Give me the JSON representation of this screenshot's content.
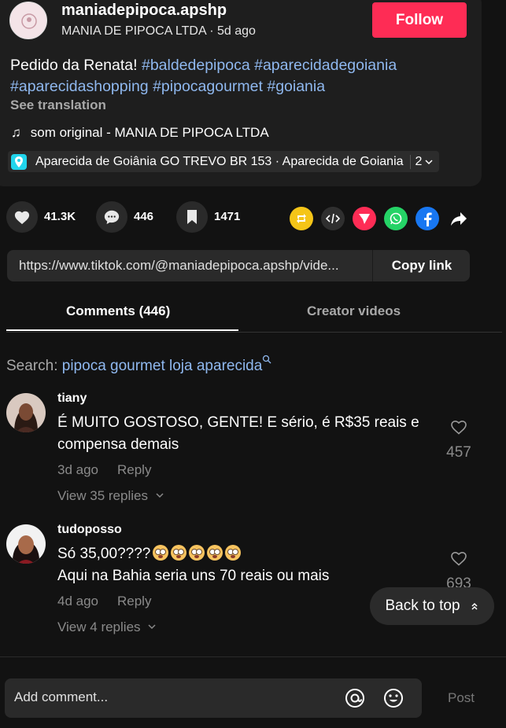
{
  "header": {
    "username": "maniadepipoca.apshp",
    "display_name": "MANIA DE PIPOCA LTDA",
    "separator": " · ",
    "time_ago": "5d ago",
    "follow_label": "Follow"
  },
  "description": {
    "text": "Pedido da Renata! ",
    "tags": [
      "#baldedepipoca",
      "#aparecidadegoiania",
      "#aparecidashopping",
      "#pipocagourmet",
      "#goiania"
    ],
    "see_translation": "See translation"
  },
  "music": {
    "note": "♫",
    "label": "som original - MANIA DE PIPOCA LTDA"
  },
  "location": {
    "text": "Aparecida de Goiânia GO TREVO BR 153 · Aparecida de Goiania",
    "count": "2"
  },
  "actions": {
    "likes": "41.3K",
    "comments": "446",
    "saves": "1471"
  },
  "link": {
    "url": "https://www.tiktok.com/@maniadepipoca.apshp/vide...",
    "copy_label": "Copy link"
  },
  "tabs": {
    "comments": "Comments (446)",
    "creator": "Creator videos"
  },
  "search": {
    "label": "Search: ",
    "query": "pipoca gourmet loja aparecida"
  },
  "comments": [
    {
      "user": "tiany",
      "line1": "É MUITO GOSTOSO, GENTE! E sério, é R$35 reais e",
      "line2": "compensa demais",
      "time": "3d ago",
      "reply": "Reply",
      "view_replies": "View 35 replies",
      "likes": "457"
    },
    {
      "user": "tudoposso",
      "line1": "Só 35,00????",
      "line2": "Aqui na Bahia seria uns 70 reais ou mais",
      "time": "4d ago",
      "reply": "Reply",
      "view_replies": "View 4 replies",
      "likes": "693"
    }
  ],
  "back_to_top": "Back to top",
  "composer": {
    "placeholder": "Add comment...",
    "post_label": "Post"
  },
  "colors": {
    "accent": "#fe2c55",
    "hashtag": "#8fb8ef",
    "location_pin": "#20d5ec"
  },
  "icons": [
    "heart-icon",
    "comment-icon",
    "bookmark-icon",
    "repost-icon",
    "embed-icon",
    "send-icon",
    "whatsapp-icon",
    "facebook-icon",
    "share-arrow-icon",
    "at-icon",
    "emoji-icon"
  ]
}
